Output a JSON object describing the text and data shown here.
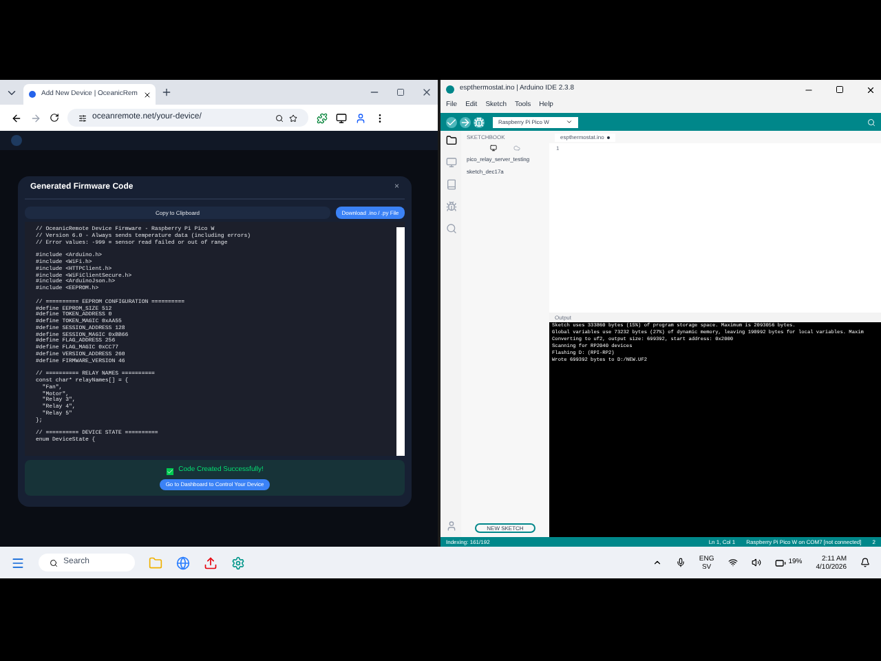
{
  "browser": {
    "tab_title": "Add New Device | OceanicRem",
    "url": "oceanremote.net/your-device/",
    "modal": {
      "title": "Generated Firmware Code",
      "close": "×",
      "copy_button": "Copy to Clipboard",
      "download_button": "Download .ino / .py File",
      "code_blocks": [
        [
          "// OceanicRemote Device Firmware - Raspberry Pi Pico W",
          "// Version 6.0 - Always sends temperature data (including errors)",
          "// Error values: -999 = sensor read failed or out of range"
        ],
        [
          "#include <Arduino.h>",
          "#include <WiFi.h>",
          "#include <HTTPClient.h>",
          "#include <WiFiClientSecure.h>",
          "#include <ArduinoJson.h>",
          "#include <EEPROM.h>"
        ],
        [
          "// ========== EEPROM CONFIGURATION ==========",
          "#define EEPROM_SIZE 512",
          "#define TOKEN_ADDRESS 0",
          "#define TOKEN_MAGIC 0xAA55",
          "#define SESSION_ADDRESS 128",
          "#define SESSION_MAGIC 0xBB66",
          "#define FLAG_ADDRESS 256",
          "#define FLAG_MAGIC 0xCC77",
          "#define VERSION_ADDRESS 260",
          "#define FIRMWARE_VERSION 46"
        ],
        [
          "// ========== RELAY NAMES ==========",
          "const char* relayNames[] = {",
          "  \"Fan\",",
          "  \"Motor\",",
          "  \"Relay 3\",",
          "  \"Relay 4\",",
          "  \"Relay 5\"",
          "};"
        ],
        [
          "// ========== DEVICE STATE ==========",
          "enum DeviceState {"
        ]
      ],
      "success_message": "Code Created Successfully!",
      "dashboard_button": "Go to Dashboard to Control Your Device"
    }
  },
  "arduino": {
    "title": "espthermostat.ino | Arduino IDE 2.3.8",
    "menu": [
      "File",
      "Edit",
      "Sketch",
      "Tools",
      "Help"
    ],
    "board": "Raspberry Pi Pico W",
    "sketchbook_heading": "SKETCHBOOK",
    "sketches": [
      "pico_relay_server_testing",
      "sketch_dec17a"
    ],
    "editor_tab": "espthermostat.ino",
    "line_number": "1",
    "output_label": "Output",
    "output_lines": [
      "Sketch uses 333860 bytes (15%) of program storage space. Maximum is 2093056 bytes.",
      "Global variables use 73232 bytes (27%) of dynamic memory, leaving 190992 bytes for local variables. Maxim",
      "Converting to uf2, output size: 699392, start address: 0x2000",
      "Scanning for RP2040 devices",
      "Flashing D: (RPI-RP2)",
      "Wrote 699392 bytes to D:/NEW.UF2"
    ],
    "new_sketch_button": "NEW SKETCH",
    "status_left": "Indexing: 161/192",
    "status_position": "Ln 1, Col 1",
    "status_board": "Raspberry Pi Pico W on COM7 [not connected]",
    "notification_count": "2"
  },
  "taskbar": {
    "search_placeholder": "Search",
    "language": "ENG",
    "layout": "SV",
    "battery": "19%",
    "time": "2:11 AM",
    "date": "4/10/2026"
  }
}
